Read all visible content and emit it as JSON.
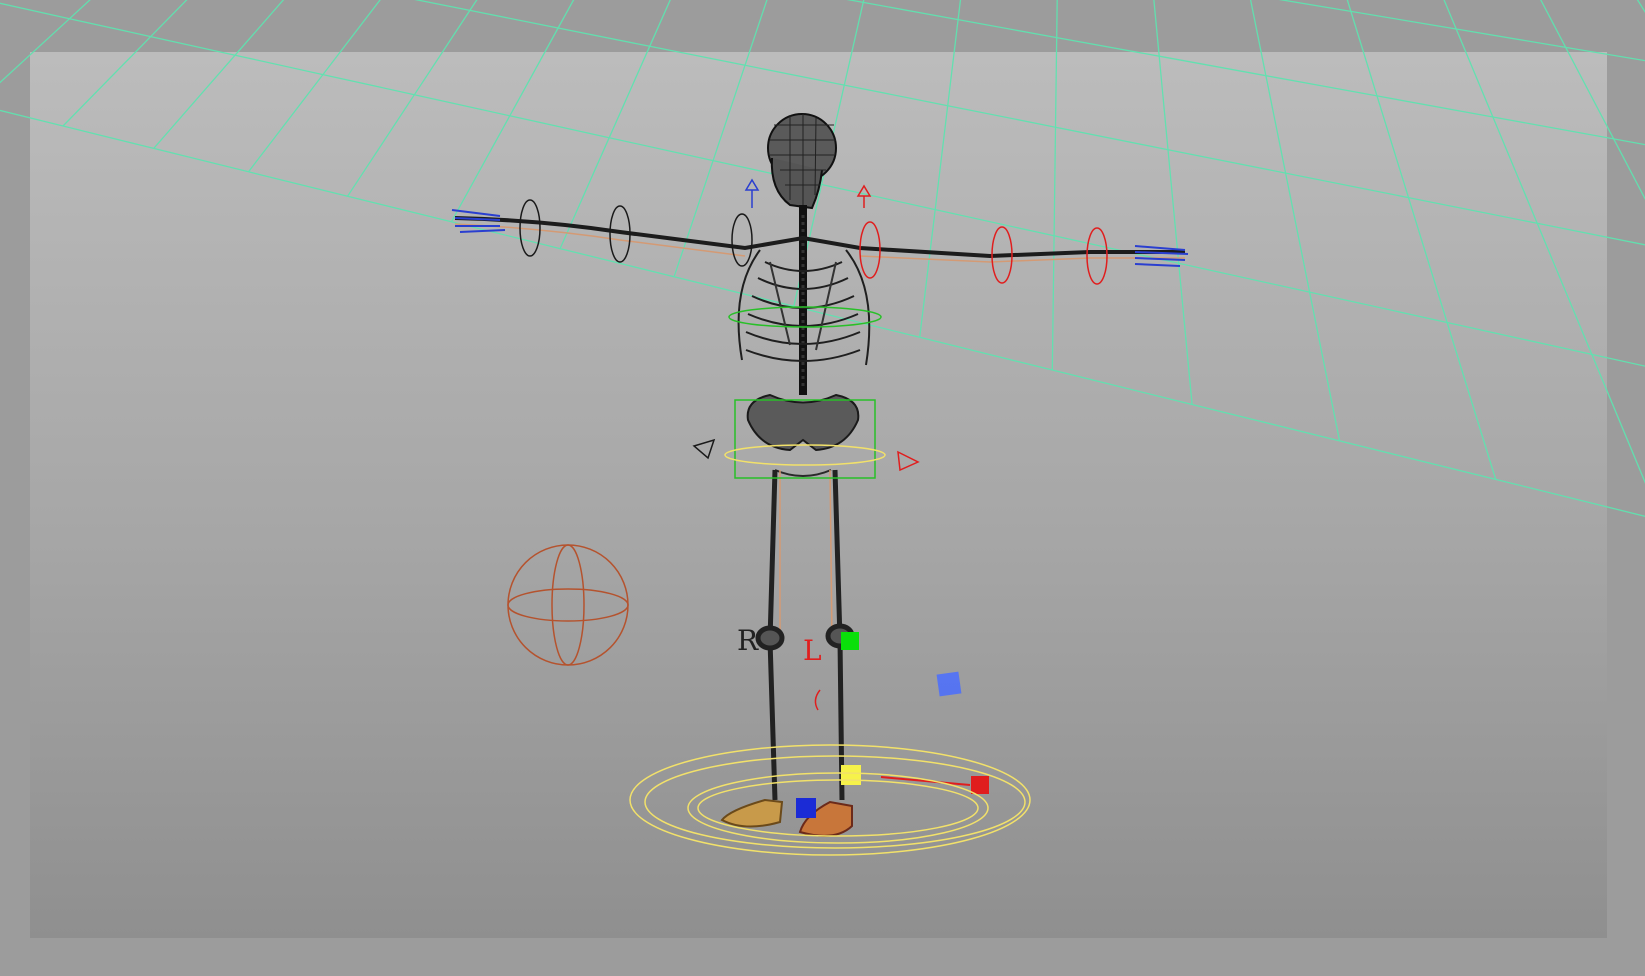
{
  "viewport": {
    "name": "3d-perspective-viewport",
    "grid_color": "#5fe3b0",
    "safe_frame_color": "#bdbdbd"
  },
  "rig": {
    "side_labels": {
      "right": "R",
      "left": "L"
    },
    "colors": {
      "right_side": "#1b2bd6",
      "left_side": "#e01e1e",
      "center": "#28c028",
      "foot_ctrl": "#f2e16a",
      "world_sphere": "#b5532e",
      "wireframe": "#1a1a1a",
      "bone": "#c8906b"
    },
    "controls": [
      {
        "name": "pole-vector-left-knee",
        "color": "#0adf0a"
      },
      {
        "name": "foot-ik-handle",
        "color": "#f6f24a"
      },
      {
        "name": "foot-pivot-right",
        "color": "#1b2bd6"
      },
      {
        "name": "foot-pivot-left",
        "color": "#e01e1e"
      },
      {
        "name": "pole-vector-knee-target",
        "color": "#4a6dff"
      }
    ]
  }
}
